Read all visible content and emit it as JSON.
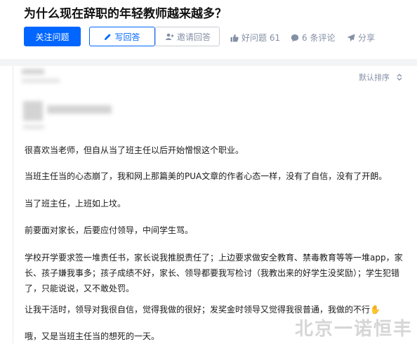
{
  "question": {
    "title": "为什么现在辞职的年轻教师越来越多？"
  },
  "actions": {
    "follow_label": "关注问题",
    "answer_label": "写回答",
    "invite_label": "邀请回答",
    "upvote_label": "好问题 61",
    "comment_label": "6 条评论",
    "share_label": "分享"
  },
  "answer": {
    "sort_label": "默认排序",
    "paragraphs": [
      "很喜欢当老师，但自从当了班主任以后开始憎恨这个职业。",
      "当班主任当的心态崩了，我和网上那篇美的PUA文章的作者心态一样，没有了自信，没有了开朗。",
      "当了班主任，上班如上坟。",
      "前要面对家长，后要应付领导，中间学生骂。",
      "学校开学要求签一堆责任书，家长说我推脱责任了；上边要求做安全教育、禁毒教育等等一堆app，家长、孩子嫌我事多；孩子成绩不好，家长、领导都要我写检讨（我教出来的好学生没奖励）；学生犯错了，只能说说，又不敢处罚。",
      "让我干活时，领导对我很自信，觉得我做的很好；发奖金时领导又觉得我很普通，我做的不行✋",
      "哦，又是当班主任当的想死的一天。"
    ]
  },
  "watermark": "北京一诺恒丰",
  "colors": {
    "primary": "#0066ff",
    "muted": "#8590a6",
    "divider": "#f3f4f6"
  }
}
